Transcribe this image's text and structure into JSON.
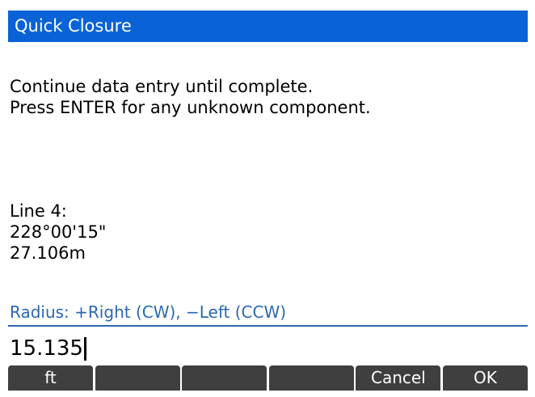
{
  "title": "Quick Closure",
  "instructions": {
    "line1": "Continue data entry until complete.",
    "line2": "Press ENTER for any unknown component."
  },
  "line_info": {
    "label": "Line 4:",
    "bearing": "228°00'15\"",
    "distance": "27.106m"
  },
  "prompt": "Radius: +Right (CW), −Left (CCW)",
  "entry": {
    "value": "15.135"
  },
  "softkeys": [
    "ft",
    "",
    "",
    "",
    "Cancel",
    "OK"
  ],
  "colors": {
    "title_bar": "#0a63d6",
    "prompt_text": "#2a69b3",
    "softkey_bg": "#3f3f3f"
  }
}
